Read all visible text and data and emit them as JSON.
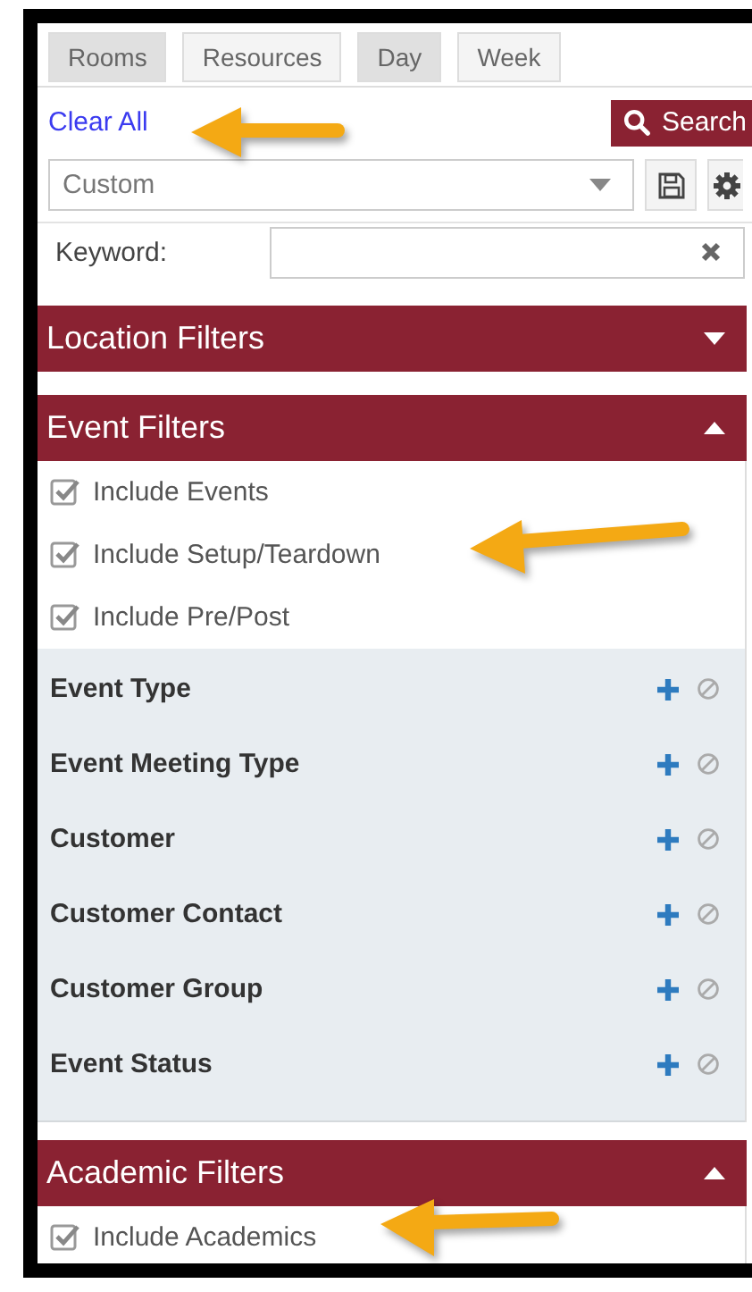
{
  "view_tabs": [
    {
      "label": "Rooms",
      "selected": true
    },
    {
      "label": "Resources",
      "selected": false
    }
  ],
  "range_tabs": [
    {
      "label": "Day",
      "selected": true
    },
    {
      "label": "Week",
      "selected": false
    }
  ],
  "clear_all": "Clear All",
  "search_button": "Search",
  "saved_search": {
    "value": "Custom"
  },
  "keyword": {
    "label": "Keyword:"
  },
  "sections": [
    {
      "title": "Location Filters",
      "expanded": false
    },
    {
      "title": "Event Filters",
      "expanded": true,
      "checkboxes": [
        {
          "label": "Include Events",
          "checked": true
        },
        {
          "label": "Include Setup/Teardown",
          "checked": true
        },
        {
          "label": "Include Pre/Post",
          "checked": true
        }
      ],
      "filters": [
        "Event Type",
        "Event Meeting Type",
        "Customer",
        "Customer Contact",
        "Customer Group",
        "Event Status"
      ]
    },
    {
      "title": "Academic Filters",
      "expanded": true,
      "checkboxes": [
        {
          "label": "Include Academics",
          "checked": true
        }
      ]
    }
  ]
}
